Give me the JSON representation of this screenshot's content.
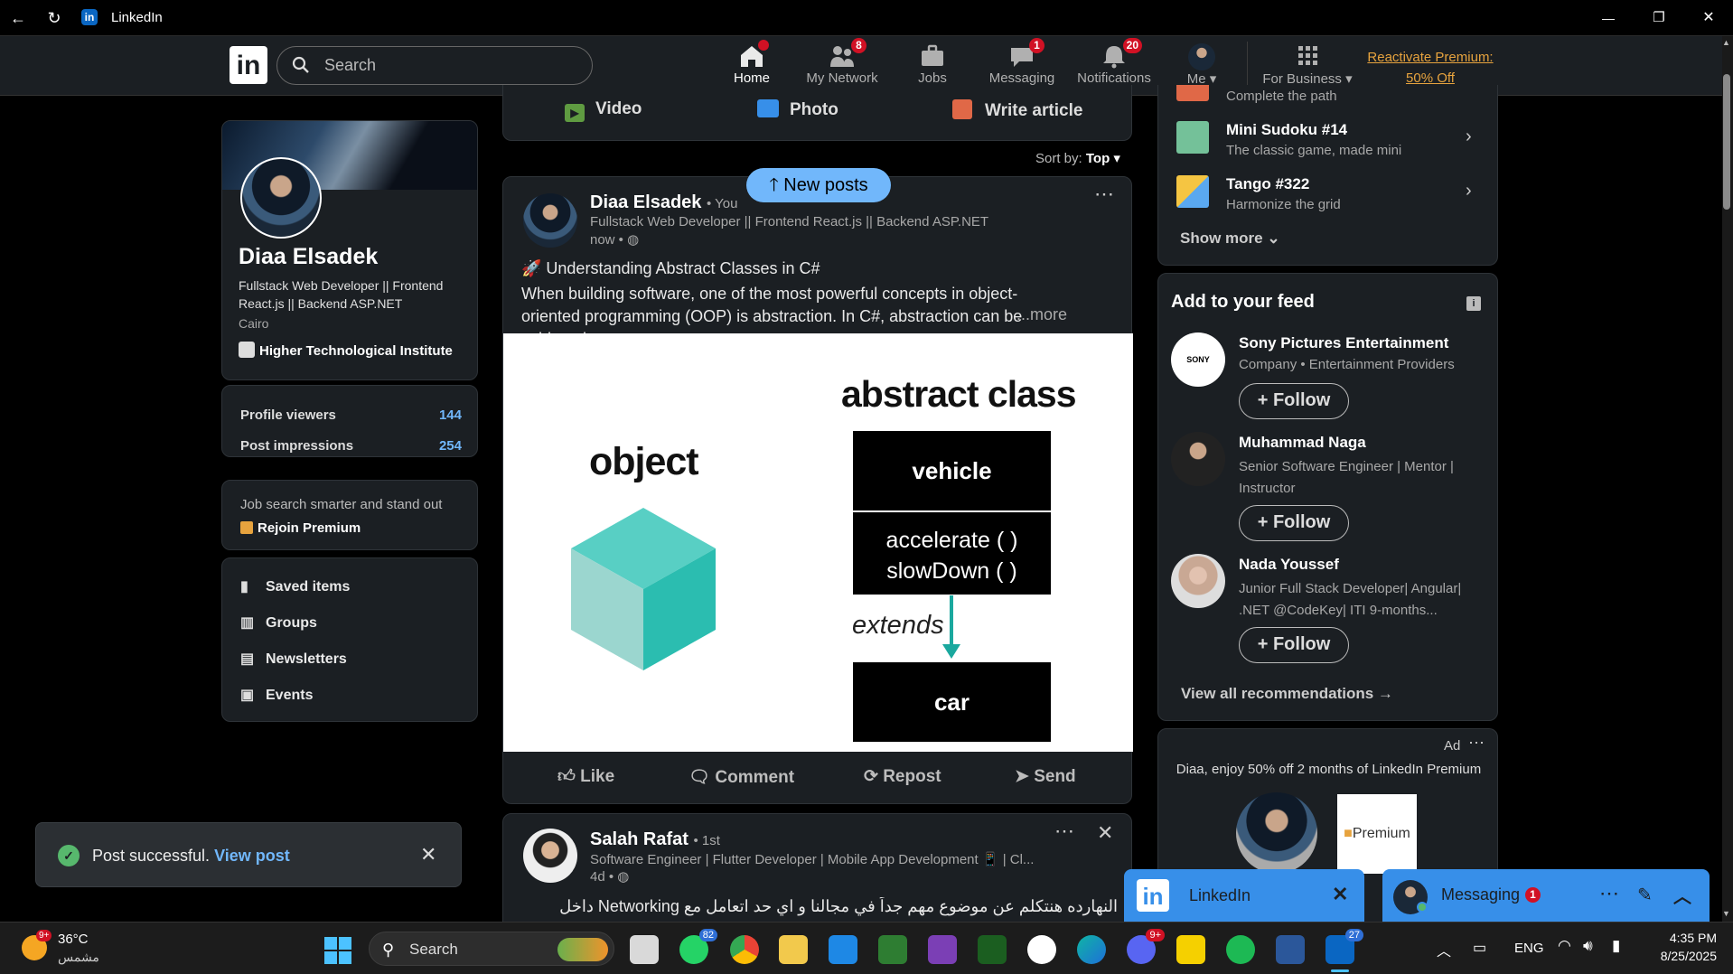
{
  "window": {
    "title": "LinkedIn",
    "back": "←",
    "reload": "↻",
    "minimize": "—",
    "maximize": "❐",
    "close": "✕"
  },
  "nav": {
    "search_placeholder": "Search",
    "items": [
      {
        "label": "Home",
        "badge": ""
      },
      {
        "label": "My Network",
        "badge": "8"
      },
      {
        "label": "Jobs",
        "badge": ""
      },
      {
        "label": "Messaging",
        "badge": "1"
      },
      {
        "label": "Notifications",
        "badge": "20"
      },
      {
        "label": "Me",
        "badge": ""
      },
      {
        "label": "For Business",
        "badge": ""
      }
    ],
    "premium_line1": "Reactivate Premium:",
    "premium_line2": "50% Off"
  },
  "profile": {
    "name": "Diaa Elsadek",
    "headline": "Fullstack Web Developer || Frontend React.js || Backend ASP.NET",
    "location": "Cairo",
    "school": "Higher Technological Institute",
    "stats": [
      {
        "label": "Profile viewers",
        "value": "144"
      },
      {
        "label": "Post impressions",
        "value": "254"
      }
    ],
    "premium_prompt": "Job search smarter and stand out",
    "premium_link": "Rejoin Premium",
    "menu": [
      "Saved items",
      "Groups",
      "Newsletters",
      "Events"
    ]
  },
  "composer": {
    "video": "Video",
    "photo": "Photo",
    "article": "Write article"
  },
  "sort": {
    "label": "Sort by:",
    "value": "Top"
  },
  "new_posts": "New posts",
  "post1": {
    "author": "Diaa Elsadek",
    "relation": "• You",
    "headline": "Fullstack Web Developer || Frontend React.js || Backend ASP.NET",
    "time": "now •",
    "title": "🚀 Understanding Abstract Classes in C#",
    "body": "When building software, one of the most powerful concepts in object-oriented programming (OOP) is abstraction. In C#, abstraction can be achieved",
    "more": "...more",
    "image": {
      "object_label": "object",
      "abstract_label": "abstract class",
      "box1": "vehicle",
      "box2a": "accelerate ( )",
      "box2b": "slowDown ( )",
      "extends": "extends",
      "box3": "car"
    },
    "actions": [
      "Like",
      "Comment",
      "Repost",
      "Send"
    ]
  },
  "post2": {
    "author": "Salah Rafat",
    "relation": "• 1st",
    "headline": "Software Engineer | Flutter Developer | Mobile App Development 📱 | Cl...",
    "time": "4d •",
    "body": "النهارده هنتكلم عن موضوع مهم جداً في مجالنا و اي حد اتعامل مع Networking داخل"
  },
  "games": [
    {
      "title": "",
      "sub": "Complete the path"
    },
    {
      "title": "Mini Sudoku #14",
      "sub": "The classic game, made mini"
    },
    {
      "title": "Tango #322",
      "sub": "Harmonize the grid"
    }
  ],
  "show_more": "Show more",
  "feed": {
    "title": "Add to your feed",
    "items": [
      {
        "name": "Sony Pictures Entertainment",
        "sub": "Company • Entertainment Providers",
        "follow": "Follow"
      },
      {
        "name": "Muhammad Naga",
        "sub": "Senior Software Engineer | Mentor | Instructor",
        "follow": "Follow"
      },
      {
        "name": "Nada Youssef",
        "sub": "Junior Full Stack Developer| Angular| .NET @CodeKey| ITI 9-months...",
        "follow": "Follow"
      }
    ],
    "view_all": "View all recommendations →"
  },
  "ad": {
    "label": "Ad",
    "text": "Diaa, enjoy 50% off 2 months of LinkedIn Premium",
    "premium": "Premium"
  },
  "toast": {
    "text": "Post successful.",
    "link": "View post"
  },
  "chat_linkedin": {
    "title": "LinkedIn"
  },
  "chat_messaging": {
    "title": "Messaging",
    "badge": "1"
  },
  "taskbar": {
    "weather_temp": "36°C",
    "weather_desc": "مشمس",
    "weather_badge": "9+",
    "search": "Search",
    "whatsapp_badge": "82",
    "discord_badge": "9+",
    "linkedin_badge": "27",
    "lang": "ENG",
    "time": "4:35 PM",
    "date": "8/25/2025"
  },
  "colors": {
    "accent": "#71b7fb",
    "badge": "#d11124",
    "premium": "#e7a33e",
    "bg": "#000000",
    "card": "#1b1f23"
  }
}
